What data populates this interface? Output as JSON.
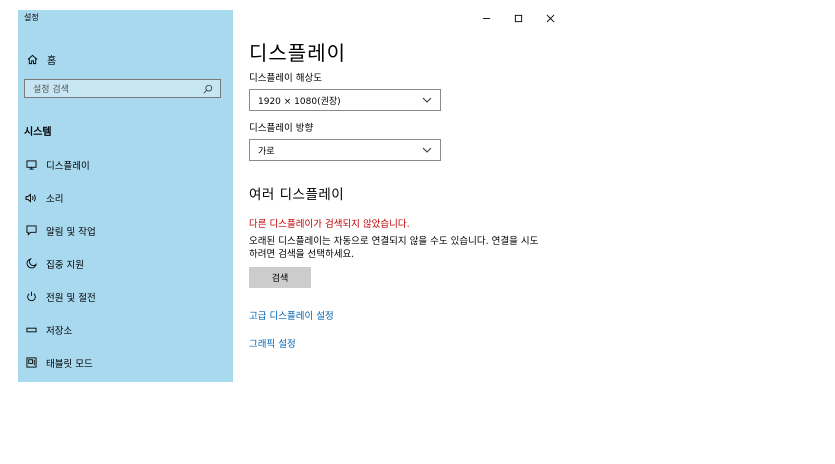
{
  "window": {
    "title": "설정",
    "minimize_icon": "minimize-icon",
    "maximize_icon": "maximize-icon",
    "close_icon": "close-icon"
  },
  "sidebar": {
    "home_label": "홈",
    "search_placeholder": "설정 검색",
    "section_title": "시스템",
    "items": [
      {
        "label": "디스플레이",
        "icon": "monitor-icon"
      },
      {
        "label": "소리",
        "icon": "speaker-icon"
      },
      {
        "label": "알림 및 작업",
        "icon": "notification-icon"
      },
      {
        "label": "집중 지원",
        "icon": "moon-icon"
      },
      {
        "label": "전원 및 절전",
        "icon": "power-icon"
      },
      {
        "label": "저장소",
        "icon": "storage-icon"
      },
      {
        "label": "태블릿 모드",
        "icon": "tablet-icon"
      }
    ]
  },
  "main": {
    "title": "디스플레이",
    "resolution_label": "디스플레이 해상도",
    "resolution_value": "1920 × 1080(권장)",
    "orientation_label": "디스플레이 방향",
    "orientation_value": "가로",
    "multi_title": "여러 디스플레이",
    "error_text": "다른 디스플레이가 검색되지 않았습니다.",
    "description": "오래된 디스플레이는 자동으로 연결되지 않을 수도 있습니다. 연결을 시도하려면 검색을 선택하세요.",
    "detect_button": "검색",
    "advanced_link": "고급 디스플레이 설정",
    "graphics_link": "그래픽 설정"
  },
  "colors": {
    "sidebar_bg": "#a9d9ef",
    "error": "#c00000",
    "link": "#0063b1"
  }
}
